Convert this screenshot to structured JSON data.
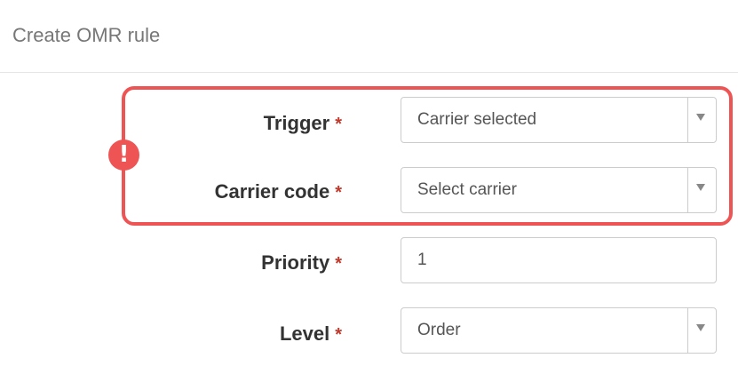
{
  "header": {
    "title": "Create OMR rule"
  },
  "form": {
    "trigger": {
      "label": "Trigger",
      "required_mark": "*",
      "value": "Carrier selected",
      "icon": "chevron-down-icon"
    },
    "carrier_code": {
      "label": "Carrier code",
      "required_mark": "*",
      "value": "Select carrier",
      "icon": "chevron-down-icon"
    },
    "priority": {
      "label": "Priority",
      "required_mark": "*",
      "value": "1"
    },
    "level": {
      "label": "Level",
      "required_mark": "*",
      "value": "Order",
      "icon": "chevron-down-icon"
    }
  },
  "validation": {
    "icon": "exclamation-icon",
    "icon_glyph": "!",
    "color": "#ef5455"
  },
  "colors": {
    "required": "#c0392b",
    "highlight": "#ef5455"
  }
}
